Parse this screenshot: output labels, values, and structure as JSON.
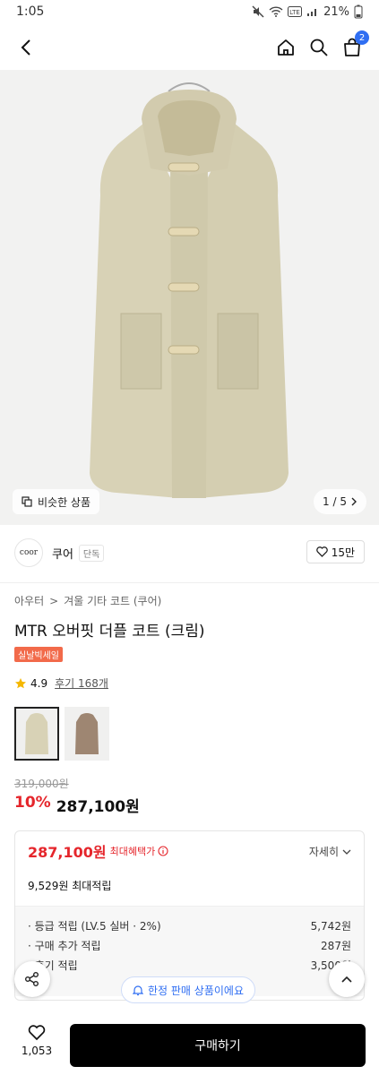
{
  "status": {
    "time": "1:05",
    "battery": "21%"
  },
  "hero": {
    "similar_label": "비슷한 상품",
    "pager": "1 / 5"
  },
  "brand": {
    "logo_text": "coor",
    "name": "쿠어",
    "badge": "단독",
    "likes": "15만"
  },
  "breadcrumb": [
    "아우터",
    "겨울 기타 코트 (쿠어)"
  ],
  "product": {
    "title": "MTR 오버핏 더플 코트 (크림)",
    "sale_badge": "실날빅세일",
    "rating": "4.9",
    "reviews": "후기 168개",
    "original_price": "319,000원",
    "discount": "10%",
    "price": "287,100원"
  },
  "benefit": {
    "price": "287,100원",
    "label": "최대혜택가",
    "detail": "자세히",
    "max_points": "9,529원 최대적립",
    "rows": [
      {
        "label": "· 등급 적립 (LV.5 실버 · 2%)",
        "value": "5,742원"
      },
      {
        "label": "· 구매 추가 적립",
        "value": "287원"
      },
      {
        "label": "· 후기 적립",
        "value": "3,500원"
      }
    ]
  },
  "toast": {
    "limited": "한정 판매 상품이에요"
  },
  "bottom": {
    "wish_count": "1,053",
    "buy_label": "구매하기"
  },
  "colors": {
    "accent_red": "#e5262c",
    "accent_blue": "#2f6ef2",
    "coat": "#d8d2b6"
  }
}
